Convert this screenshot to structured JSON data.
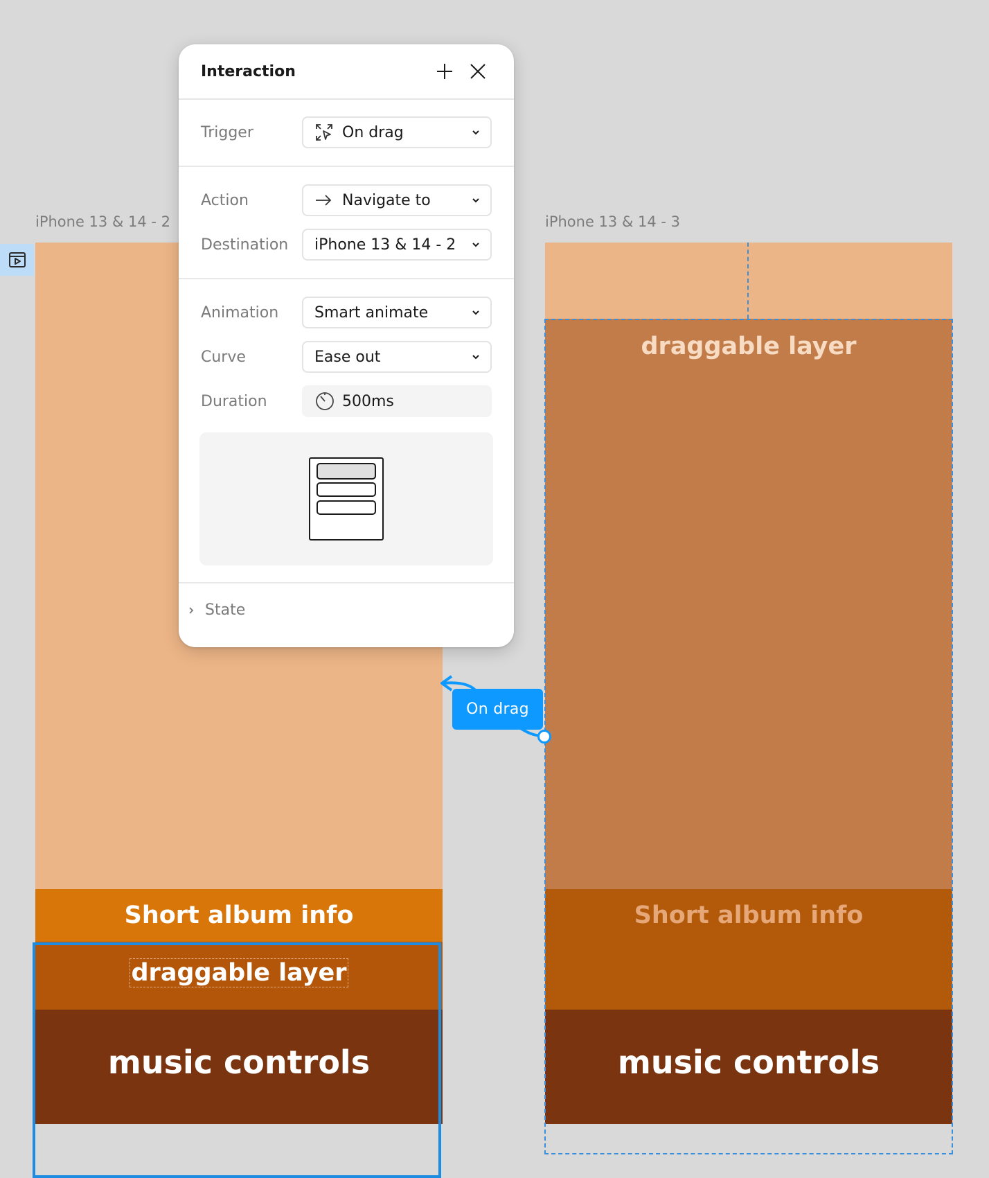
{
  "canvas": {
    "frame_left_label": "iPhone 13 & 14 - 2",
    "frame_right_label": "iPhone 13 & 14 - 3"
  },
  "frame_left": {
    "album_info": "Short album info",
    "draggable": "draggable layer",
    "controls": "music controls"
  },
  "frame_right": {
    "draggable": "draggable layer",
    "album_info": "Short album info",
    "controls": "music controls"
  },
  "connector": {
    "label": "On drag"
  },
  "panel": {
    "title": "Interaction",
    "trigger_label": "Trigger",
    "trigger_value": "On drag",
    "action_label": "Action",
    "action_value": "Navigate to",
    "destination_label": "Destination",
    "destination_value": "iPhone 13 & 14 - 2",
    "animation_label": "Animation",
    "animation_value": "Smart animate",
    "curve_label": "Curve",
    "curve_value": "Ease out",
    "duration_label": "Duration",
    "duration_value": "500ms",
    "state_label": "State"
  },
  "colors": {
    "peach": "#ecb587",
    "orange": "#d97609",
    "rust": "#b3560a",
    "brown": "#7a3510",
    "terracotta": "#c27c4a",
    "accent_blue": "#0d99ff"
  }
}
